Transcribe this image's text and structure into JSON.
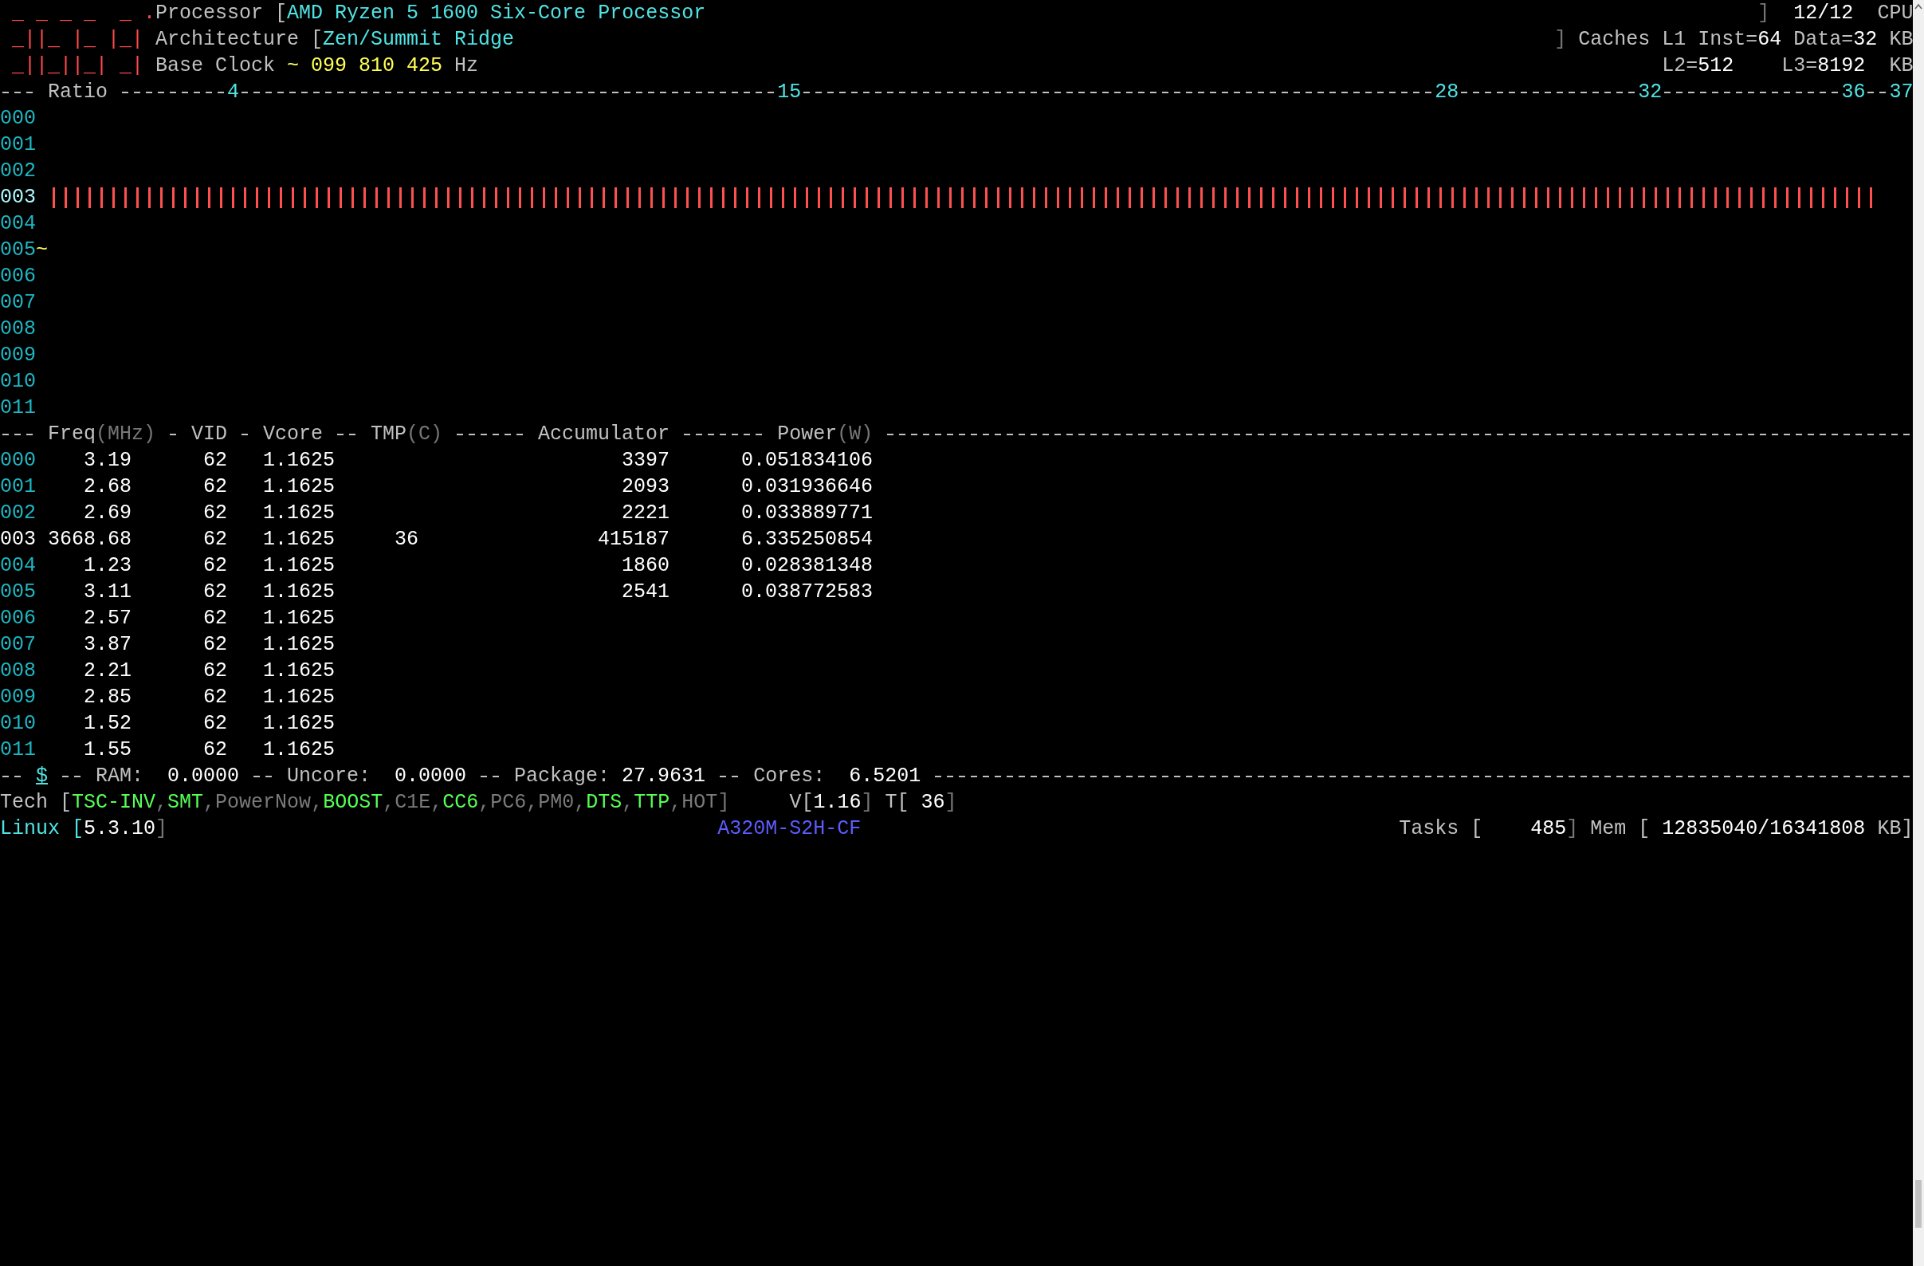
{
  "header": {
    "logo": [
      " _ _ _ _  _ .",
      " _||_ |_ |_|",
      " _||_||_| _|"
    ],
    "processor": {
      "label": "Processor [",
      "value": "AMD Ryzen 5 1600 Six-Core Processor",
      "close": "]",
      "count": "12/12",
      "count_label": "CPU"
    },
    "architecture": {
      "label": "Architecture [",
      "value": "Zen/Summit Ridge",
      "close": "]",
      "caches_label": "Caches L1",
      "items": [
        {
          "label": "Inst=",
          "value": "64"
        },
        {
          "label": "Data=",
          "value": "32"
        }
      ],
      "unit": "KB"
    },
    "base_clock": {
      "label": "Base Clock",
      "approx": "~",
      "value": "099 810 425",
      "unit": "Hz",
      "items": [
        {
          "label": "L2=",
          "value": "512"
        },
        {
          "label": "L3=",
          "value": "8192"
        }
      ],
      "cache_unit": "KB"
    }
  },
  "ratio_ruler": {
    "label": "Ratio",
    "ticks": [
      "4",
      "15",
      "28",
      "32",
      "36",
      "37"
    ]
  },
  "cores": [
    {
      "id": "000",
      "selected": false
    },
    {
      "id": "001",
      "selected": false
    },
    {
      "id": "002",
      "selected": false
    },
    {
      "id": "003",
      "selected": true
    },
    {
      "id": "004",
      "selected": false
    },
    {
      "id": "005",
      "selected": false,
      "marker": "~"
    },
    {
      "id": "006",
      "selected": false
    },
    {
      "id": "007",
      "selected": false
    },
    {
      "id": "008",
      "selected": false
    },
    {
      "id": "009",
      "selected": false
    },
    {
      "id": "010",
      "selected": false
    },
    {
      "id": "011",
      "selected": false
    }
  ],
  "table": {
    "columns": [
      {
        "label": "Freq",
        "unit": "(MHz)"
      },
      {
        "label": "VID"
      },
      {
        "label": "Vcore"
      },
      {
        "label": "TMP",
        "unit": "(C)"
      },
      {
        "label": "Accumulator"
      },
      {
        "label": "Power",
        "unit": "(W)"
      }
    ],
    "rows": [
      {
        "id": "000",
        "selected": false,
        "freq": "3.19",
        "vid": "62",
        "vcore": "1.1625",
        "accumulator": "3397",
        "power": "0.051834106"
      },
      {
        "id": "001",
        "selected": false,
        "freq": "2.68",
        "vid": "62",
        "vcore": "1.1625",
        "accumulator": "2093",
        "power": "0.031936646"
      },
      {
        "id": "002",
        "selected": false,
        "freq": "2.69",
        "vid": "62",
        "vcore": "1.1625",
        "accumulator": "2221",
        "power": "0.033889771"
      },
      {
        "id": "003",
        "selected": true,
        "freq": "3668.68",
        "vid": "62",
        "vcore": "1.1625",
        "tmp": "36",
        "accumulator": "415187",
        "power": "6.335250854"
      },
      {
        "id": "004",
        "selected": false,
        "freq": "1.23",
        "vid": "62",
        "vcore": "1.1625",
        "accumulator": "1860",
        "power": "0.028381348"
      },
      {
        "id": "005",
        "selected": false,
        "freq": "3.11",
        "vid": "62",
        "vcore": "1.1625",
        "accumulator": "2541",
        "power": "0.038772583"
      },
      {
        "id": "006",
        "selected": false,
        "freq": "2.57",
        "vid": "62",
        "vcore": "1.1625"
      },
      {
        "id": "007",
        "selected": false,
        "freq": "3.87",
        "vid": "62",
        "vcore": "1.1625"
      },
      {
        "id": "008",
        "selected": false,
        "freq": "2.21",
        "vid": "62",
        "vcore": "1.1625"
      },
      {
        "id": "009",
        "selected": false,
        "freq": "2.85",
        "vid": "62",
        "vcore": "1.1625"
      },
      {
        "id": "010",
        "selected": false,
        "freq": "1.52",
        "vid": "62",
        "vcore": "1.1625"
      },
      {
        "id": "011",
        "selected": false,
        "freq": "1.55",
        "vid": "62",
        "vcore": "1.1625"
      }
    ]
  },
  "totals": {
    "symbol": "$",
    "items": [
      {
        "label": "RAM:",
        "value": "0.0000"
      },
      {
        "label": "Uncore:",
        "value": "0.0000"
      },
      {
        "label": "Package:",
        "value": "27.9631"
      },
      {
        "label": "Cores:",
        "value": "6.5201"
      }
    ]
  },
  "tech": {
    "label": "Tech [",
    "separator": ",",
    "close": "]",
    "features": [
      {
        "name": "TSC-INV",
        "on": true
      },
      {
        "name": "SMT",
        "on": true
      },
      {
        "name": "PowerNow",
        "on": false
      },
      {
        "name": "BOOST",
        "on": true
      },
      {
        "name": "C1E",
        "on": false
      },
      {
        "name": "CC6",
        "on": true
      },
      {
        "name": "PC6",
        "on": false
      },
      {
        "name": "PM0",
        "on": false
      },
      {
        "name": "DTS",
        "on": true
      },
      {
        "name": "TTP",
        "on": true
      },
      {
        "name": "HOT",
        "on": false
      }
    ],
    "voltage": {
      "label": "V[",
      "value": "1.16",
      "close": "]"
    },
    "temperature": {
      "label": "T[",
      "value": "36",
      "close": "]"
    }
  },
  "status": {
    "os": {
      "label": "Linux [",
      "value": "5.3.10",
      "close": "]"
    },
    "board": "A320M-S2H-CF",
    "tasks": {
      "label": "Tasks [",
      "value": "485",
      "close": "]"
    },
    "mem": {
      "label": "Mem [",
      "value": "12835040/16341808",
      "unit": "KB]"
    }
  }
}
